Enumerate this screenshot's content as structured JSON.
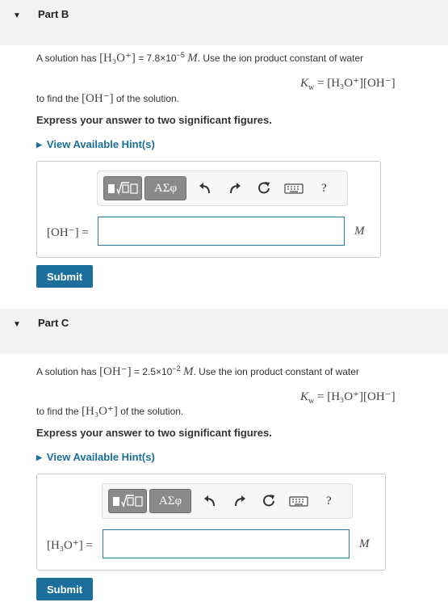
{
  "part_b": {
    "title": "Part B",
    "q_prefix": "A solution has ",
    "q_given_species": "[H₃O⁺]",
    "q_given_value": " = 7.8×10",
    "q_given_exp": "−5",
    "q_unit": "M",
    "q_suffix": ". Use the ion product constant of water",
    "kw_lhs": "K",
    "kw_sub": "w",
    "kw_rhs": " = [H₃O⁺][OH⁻]",
    "find_prefix": "to find the ",
    "find_species": "[OH⁻]",
    "find_suffix": " of the solution.",
    "instruction": "Express your answer to two significant figures.",
    "hint": "View Available Hint(s)",
    "answer_label": "[OH⁻] =",
    "answer_value": "",
    "answer_unit": "M",
    "submit": "Submit"
  },
  "part_c": {
    "title": "Part C",
    "q_prefix": "A solution has ",
    "q_given_species": "[OH⁻]",
    "q_given_value": " = 2.5×10",
    "q_given_exp": "−2",
    "q_unit": "M",
    "q_suffix": ". Use the ion product constant of water",
    "kw_lhs": "K",
    "kw_sub": "w",
    "kw_rhs": " = [H₃O⁺][OH⁻]",
    "find_prefix": "to find the ",
    "find_species": "[H₃O⁺]",
    "find_suffix": " of the solution.",
    "instruction": "Express your answer to two significant figures.",
    "hint": "View Available Hint(s)",
    "answer_label": "[H₃O⁺] =",
    "answer_value": "",
    "answer_unit": "M",
    "submit": "Submit"
  },
  "toolbar": {
    "greek_label": "ΑΣφ",
    "help_label": "?",
    "icons": [
      "templates-icon",
      "greek-symbols-icon",
      "undo-icon",
      "redo-icon",
      "reset-icon",
      "keyboard-icon",
      "help-icon"
    ]
  },
  "colors": {
    "accent": "#1b6f9a",
    "header_bg": "#f2f2f2",
    "toolbar_button": "#8a8a8a",
    "input_border": "#2a7a9f"
  }
}
